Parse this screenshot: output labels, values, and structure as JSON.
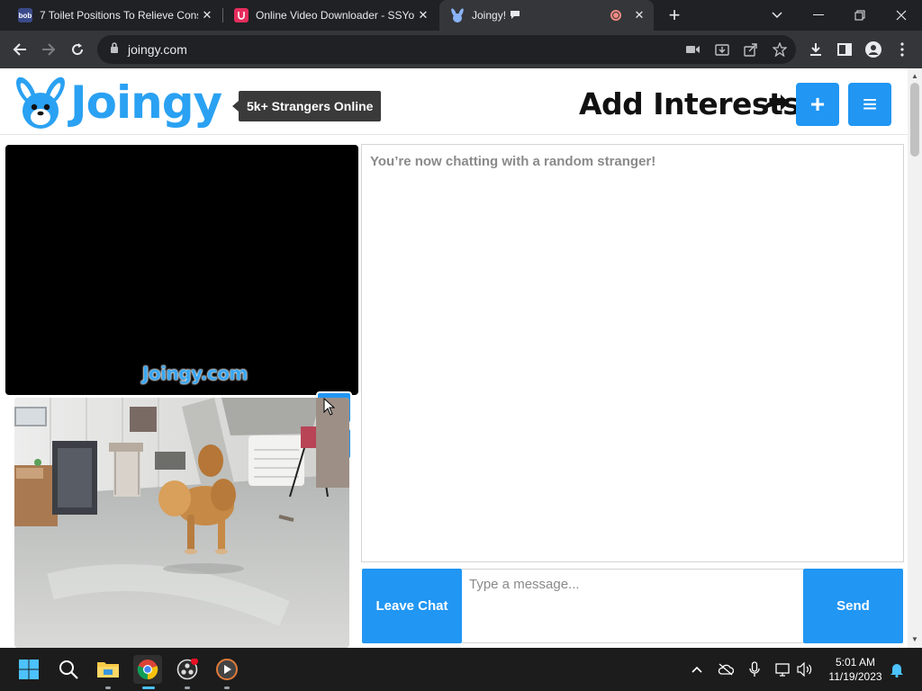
{
  "browser": {
    "tabs": [
      {
        "favicon": "bob",
        "title": "7 Toilet Positions To Relieve Cons",
        "close": "✕"
      },
      {
        "favicon": "ssyoutube-icon",
        "title": "Online Video Downloader - SSYo",
        "close": "✕"
      },
      {
        "favicon": "joingy-bunny-icon",
        "title": "Joingy!",
        "close": "✕"
      }
    ],
    "new_tab": "+",
    "url": "joingy.com"
  },
  "site": {
    "logo_text": "Joingy",
    "online_badge": "5k+ Strangers Online",
    "add_interests": "Add Interests",
    "plus_label": "+",
    "menu_label": "≡"
  },
  "video": {
    "watermark": "Joingy.com"
  },
  "chat": {
    "status_message": "You’re now chatting with a random stranger!",
    "leave_label": "Leave Chat",
    "input_placeholder": "Type a message...",
    "send_label": "Send"
  },
  "taskbar": {
    "time": "5:01 AM",
    "date": "11/19/2023"
  },
  "colors": {
    "accent": "#2196f3",
    "logo": "#2aa1f2",
    "badge_bg": "#3a3a3a",
    "chrome_dark": "#202124",
    "chrome_toolbar": "#35363a"
  }
}
